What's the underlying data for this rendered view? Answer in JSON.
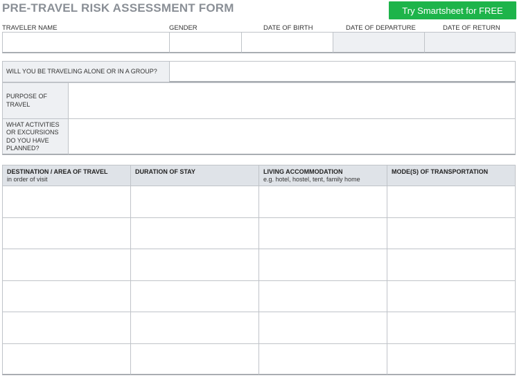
{
  "form": {
    "title": "PRE-TRAVEL RISK ASSESSMENT FORM",
    "cta_label": "Try Smartsheet for FREE"
  },
  "traveler_fields": [
    {
      "label": "TRAVELER NAME"
    },
    {
      "label": "GENDER"
    },
    {
      "label": "DATE OF BIRTH"
    },
    {
      "label": "DATE OF DEPARTURE"
    },
    {
      "label": "DATE OF RETURN"
    }
  ],
  "questions": {
    "alone_or_group": "WILL YOU BE TRAVELING ALONE OR IN A GROUP?",
    "purpose": "PURPOSE OF TRAVEL",
    "activities": "WHAT ACTIVITIES OR EXCURSIONS DO YOU HAVE PLANNED?"
  },
  "itinerary_table": {
    "columns": [
      {
        "header": "DESTINATION / AREA OF TRAVEL",
        "subheader": "in order of visit"
      },
      {
        "header": "DURATION OF STAY",
        "subheader": ""
      },
      {
        "header": "LIVING ACCOMMODATION",
        "subheader": "e.g. hotel, hostel, tent, family home"
      },
      {
        "header": "MODE(S) OF TRANSPORTATION",
        "subheader": ""
      }
    ],
    "row_count": 6
  },
  "colors": {
    "cta_green": "#1db44a",
    "title_gray": "#8a8f96",
    "header_fill": "#dfe3e8",
    "label_fill": "#eef0f3"
  }
}
